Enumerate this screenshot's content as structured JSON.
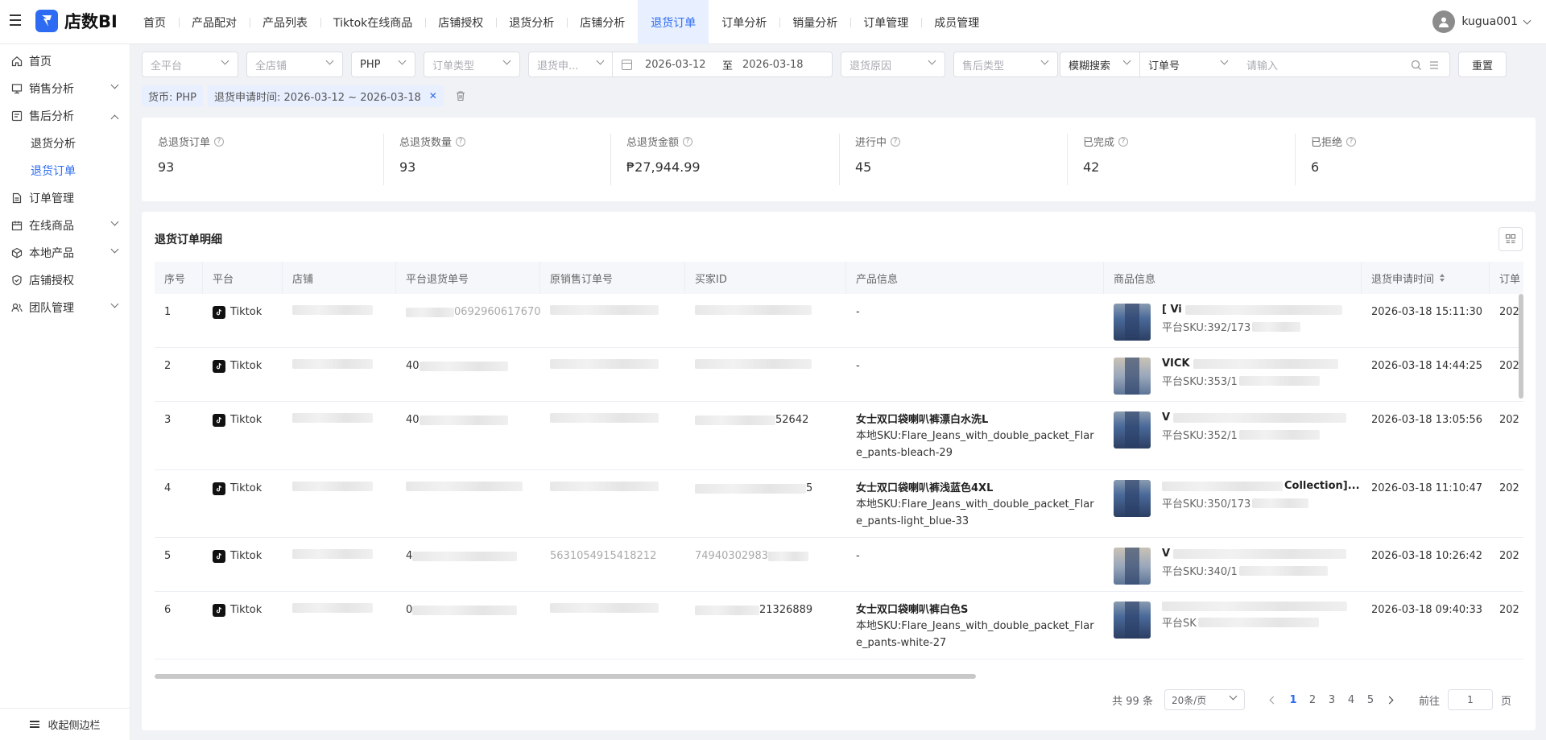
{
  "app": {
    "logo_text": "店数BI",
    "user": "kugua001"
  },
  "nav": [
    "首页",
    "产品配对",
    "产品列表",
    "Tiktok在线商品",
    "店铺授权",
    "退货分析",
    "店铺分析",
    "退货订单",
    "订单分析",
    "销量分析",
    "订单管理",
    "成员管理"
  ],
  "nav_active": "退货订单",
  "sidebar": {
    "items": [
      {
        "label": "首页"
      },
      {
        "label": "销售分析"
      },
      {
        "label": "售后分析"
      },
      {
        "label": "退货分析"
      },
      {
        "label": "退货订单"
      },
      {
        "label": "订单管理"
      },
      {
        "label": "在线商品"
      },
      {
        "label": "本地产品"
      },
      {
        "label": "店铺授权"
      },
      {
        "label": "团队管理"
      }
    ],
    "collapse_label": "收起侧边栏"
  },
  "filters": {
    "platform": "全平台",
    "store": "全店铺",
    "currency": "PHP",
    "order_type": "订单类型",
    "date_type": "退货申...",
    "date_start": "2026-03-12",
    "date_sep": "至",
    "date_end": "2026-03-18",
    "reason": "退货原因",
    "after_sale_type": "售后类型",
    "search_mode": "模糊搜索",
    "search_field": "订单号",
    "search_placeholder": "请输入",
    "reset": "重置"
  },
  "tags": {
    "currency": "货币: PHP",
    "date": "退货申请时间: 2026-03-12 ~ 2026-03-18"
  },
  "summary": [
    {
      "label": "总退货订单",
      "value": "93"
    },
    {
      "label": "总退货数量",
      "value": "93"
    },
    {
      "label": "总退货金额",
      "value": "₱27,944.99"
    },
    {
      "label": "进行中",
      "value": "45"
    },
    {
      "label": "已完成",
      "value": "42"
    },
    {
      "label": "已拒绝",
      "value": "6"
    }
  ],
  "table": {
    "title": "退货订单明细",
    "columns": [
      "序号",
      "平台",
      "店铺",
      "平台退货单号",
      "原销售订单号",
      "买家ID",
      "产品信息",
      "商品信息",
      "退货申请时间",
      "订单"
    ],
    "rows": [
      {
        "no": "1",
        "platform": "Tiktok",
        "store": "",
        "return_no": "0692960617670",
        "orig_no": "",
        "buyer": "",
        "product_name": "-",
        "product_sku": "",
        "goods_title": "[ Vi",
        "goods_sku": "平台SKU:392/173",
        "time": "2026-03-18 15:11:30",
        "order": "202"
      },
      {
        "no": "2",
        "platform": "Tiktok",
        "store": "",
        "return_no": "40",
        "orig_no": "",
        "buyer": "",
        "product_name": "-",
        "product_sku": "",
        "goods_title": "VICK",
        "goods_sku": "平台SKU:353/1",
        "time": "2026-03-18 14:44:25",
        "order": "202"
      },
      {
        "no": "3",
        "platform": "Tiktok",
        "store": "",
        "return_no": "40",
        "orig_no": "",
        "buyer": "52642",
        "product_name": "女士双口袋喇叭裤漂白水洗L",
        "product_sku": "本地SKU:Flare_Jeans_with_double_packet_Flare_pants-bleach-29",
        "goods_title": "V",
        "goods_sku": "平台SKU:352/1",
        "time": "2026-03-18 13:05:56",
        "order": "202"
      },
      {
        "no": "4",
        "platform": "Tiktok",
        "store": "",
        "return_no": "",
        "orig_no": "",
        "buyer": "5",
        "product_name": "女士双口袋喇叭裤浅蓝色4XL",
        "product_sku": "本地SKU:Flare_Jeans_with_double_packet_Flare_pants-light_blue-33",
        "goods_title": "Collection]...",
        "goods_sku": "平台SKU:350/173",
        "time": "2026-03-18 11:10:47",
        "order": "202"
      },
      {
        "no": "5",
        "platform": "Tiktok",
        "store": "",
        "return_no": "4",
        "orig_no": "5631054915418212",
        "buyer": "74940302983",
        "product_name": "-",
        "product_sku": "",
        "goods_title": "V",
        "goods_sku": "平台SKU:340/1",
        "time": "2026-03-18 10:26:42",
        "order": "202"
      },
      {
        "no": "6",
        "platform": "Tiktok",
        "store": "",
        "return_no": "0",
        "orig_no": "",
        "buyer": "21326889",
        "product_name": "女士双口袋喇叭裤白色S",
        "product_sku": "本地SKU:Flare_Jeans_with_double_packet_Flare_pants-white-27",
        "goods_title": "",
        "goods_sku": "平台SK",
        "time": "2026-03-18 09:40:33",
        "order": "202"
      }
    ]
  },
  "pager": {
    "total": "共 99 条",
    "page_size": "20条/页",
    "pages": [
      "1",
      "2",
      "3",
      "4",
      "5"
    ],
    "current": "1",
    "goto_label": "前往",
    "goto_value": "1",
    "page_suffix": "页"
  },
  "colors": {
    "accent": "#2d6cf2",
    "tag_bg": "#e8efff",
    "bg": "#f0f2f5"
  }
}
